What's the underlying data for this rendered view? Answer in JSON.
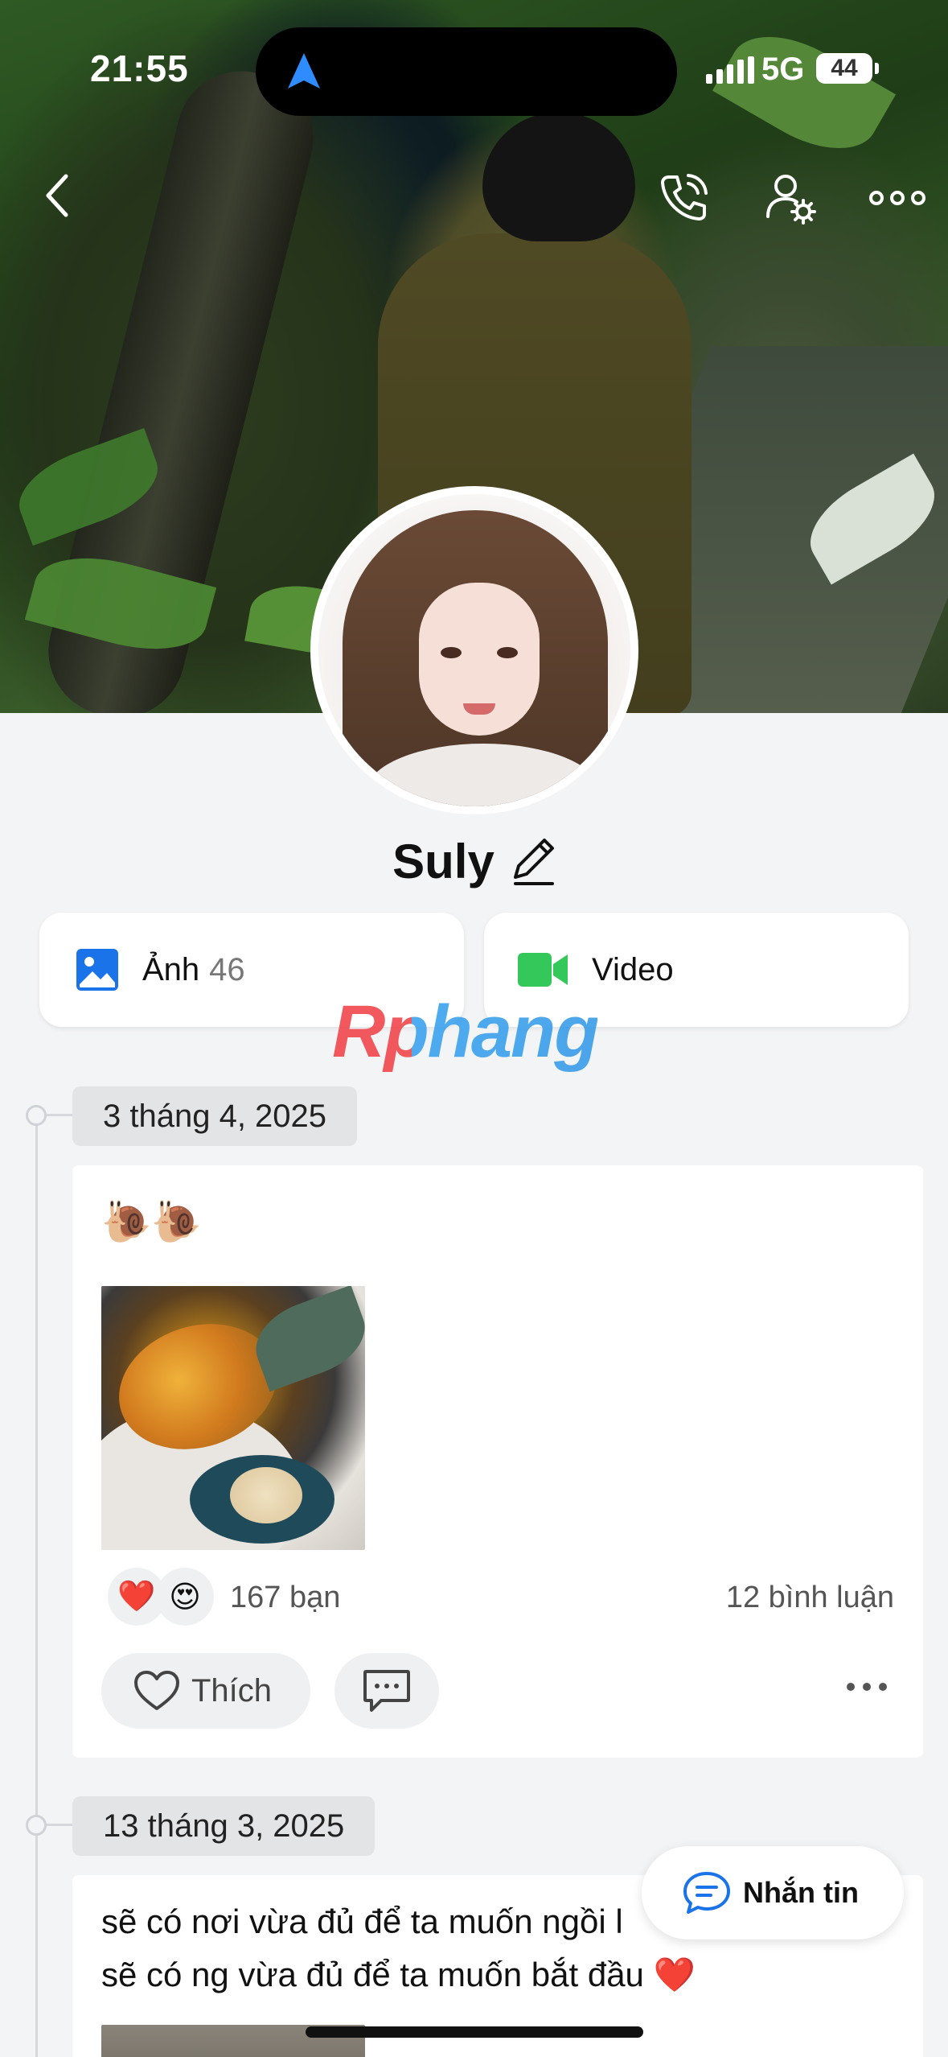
{
  "status_bar": {
    "time": "21:55",
    "network": "5G",
    "battery": "44"
  },
  "profile": {
    "name": "Suly"
  },
  "media": {
    "photos_label": "Ảnh",
    "photos_count": "46",
    "video_label": "Video"
  },
  "watermark": "Rphang",
  "timeline": [
    {
      "date": "3 tháng 4, 2025",
      "text": "🐌🐌",
      "reactions": [
        "❤️",
        "😍"
      ],
      "reaction_count": "167 bạn",
      "comment_count": "12 bình luận",
      "like_label": "Thích"
    },
    {
      "date": "13 tháng 3, 2025",
      "text_line1": "sẽ có nơi vừa đủ để ta muốn ngồi l",
      "text_line2": "sẽ có ng vừa đủ để ta muốn bắt đầu ❤️"
    }
  ],
  "chat_button": {
    "label": "Nhắn tin"
  },
  "icons": [
    "back-icon",
    "phone-icon",
    "user-settings-icon",
    "more-icon",
    "pencil-icon",
    "photo-icon",
    "video-camera-icon",
    "heart-outline-icon",
    "comment-icon",
    "chat-icon",
    "location-arrow-icon"
  ],
  "colors": {
    "accent_blue": "#1a73e8",
    "video_green": "#34c759",
    "background": "#f3f4f6"
  }
}
